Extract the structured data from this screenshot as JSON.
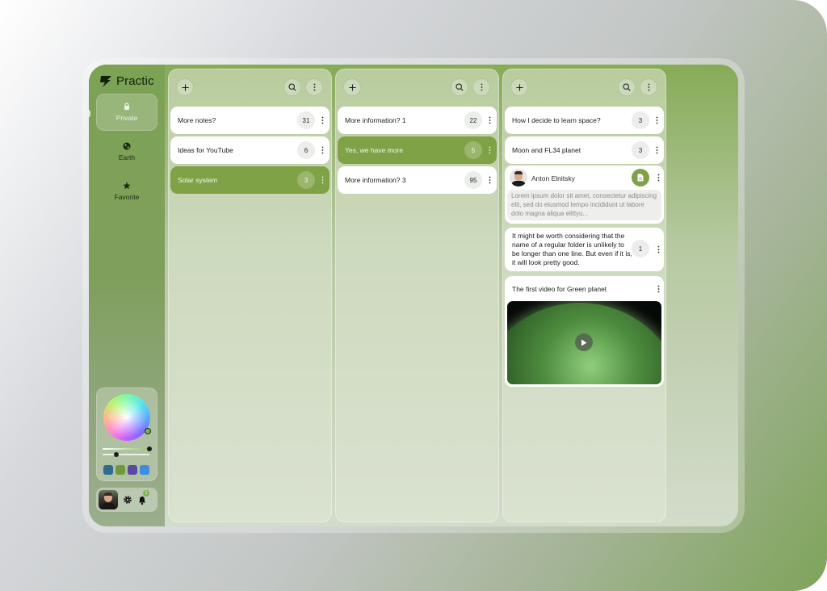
{
  "app": {
    "name": "Practic"
  },
  "sidebar": {
    "items": [
      {
        "label": "Private",
        "icon": "lock-icon",
        "active": true
      },
      {
        "label": "Earth",
        "icon": "globe-icon",
        "active": false
      },
      {
        "label": "Favorite",
        "icon": "star-icon",
        "active": false
      }
    ],
    "swatches": [
      "#2e6b8f",
      "#6f9a3c",
      "#5b4a9c",
      "#3d8ee0"
    ],
    "notifications_count": "1"
  },
  "columns": [
    {
      "cards": [
        {
          "title": "More notes?",
          "count": "31",
          "selected": false
        },
        {
          "title": "Ideas for YouTube",
          "count": "6",
          "selected": false
        },
        {
          "title": "Solar system",
          "count": "3",
          "selected": true
        }
      ]
    },
    {
      "cards": [
        {
          "title": "More information? 1",
          "count": "22",
          "selected": false
        },
        {
          "title": "Yes, we have more",
          "count": "5",
          "selected": true
        },
        {
          "title": "More information? 3",
          "count": "95",
          "selected": false
        }
      ]
    },
    {
      "cards": [
        {
          "title": "How I decide to learn space?",
          "count": "3"
        },
        {
          "title": "Moon and FL34 planet",
          "count": "3"
        }
      ],
      "person_card": {
        "name": "Anton Elnitsky",
        "text": "Lorem ipsum dolor sit amet, consectetur adipiscing elit, sed do eiusmod  tempo incididunt ut labore dolo magna aliqua elittyu..."
      },
      "long_card": {
        "text": "It might be worth considering that the name of a regular folder is unlikely to be longer than one line. But even if it is, it will look pretty good.",
        "count": "1"
      },
      "video_card": {
        "title": "The first video for Green planet"
      }
    }
  ]
}
